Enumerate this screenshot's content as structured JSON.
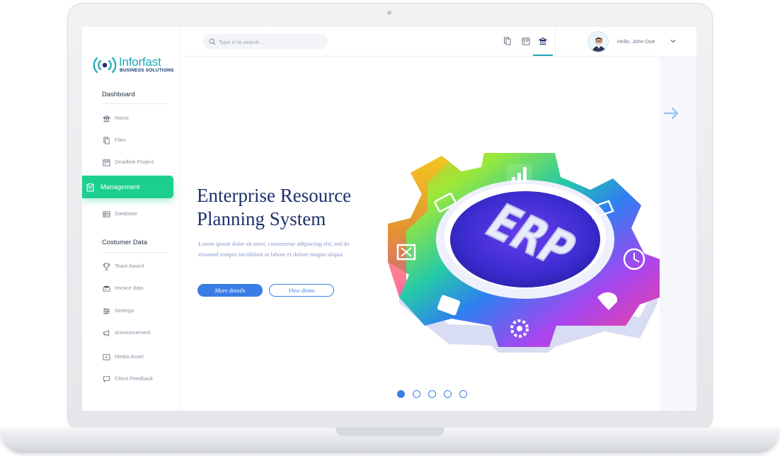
{
  "brand": {
    "name": "Inforfast",
    "tagline": "BUSINESS SOLUTIONS",
    "accent": "#1aa9b5",
    "active_green": "#1ccf8f",
    "primary_blue": "#3b7de6"
  },
  "search": {
    "placeholder": "Type in to search ..",
    "icon": "search-icon"
  },
  "topbar": {
    "icons": [
      "copy-icon",
      "calendar-icon",
      "bank-icon"
    ],
    "active_icon": "bank-icon",
    "greeting": "Hello, John Doe"
  },
  "sidebar": {
    "sections": [
      {
        "title": "Dashboard",
        "items": [
          {
            "label": "Home",
            "icon": "bank-icon"
          },
          {
            "label": "Files",
            "icon": "files-icon"
          },
          {
            "label": "Deadline Project",
            "icon": "calendar-icon"
          },
          {
            "label": "Management",
            "icon": "clipboard-icon",
            "active": true
          },
          {
            "label": "Database",
            "icon": "database-icon"
          }
        ]
      },
      {
        "title": "Costumer Data",
        "items": [
          {
            "label": "Team Award",
            "icon": "award-icon"
          },
          {
            "label": "Invoice data",
            "icon": "invoice-icon"
          },
          {
            "label": "Settings",
            "icon": "sliders-icon"
          },
          {
            "label": "Announcement",
            "icon": "megaphone-icon"
          },
          {
            "label": "Media Asset",
            "icon": "media-icon"
          },
          {
            "label": "Client Feedback",
            "icon": "chat-icon"
          }
        ]
      }
    ]
  },
  "hero": {
    "title_line1": "Enterprise Resource",
    "title_line2": "Planning System",
    "body": "Lorem ipsum dolor sit amet, consectetur adipiscing elit, sed do eiusmod tempor incididunt ut labore et dolore magna aliqua.",
    "primary_button": "More details",
    "secondary_button": "View demo",
    "illustration_text": "ERP"
  },
  "carousel": {
    "total": 5,
    "active": 1
  }
}
